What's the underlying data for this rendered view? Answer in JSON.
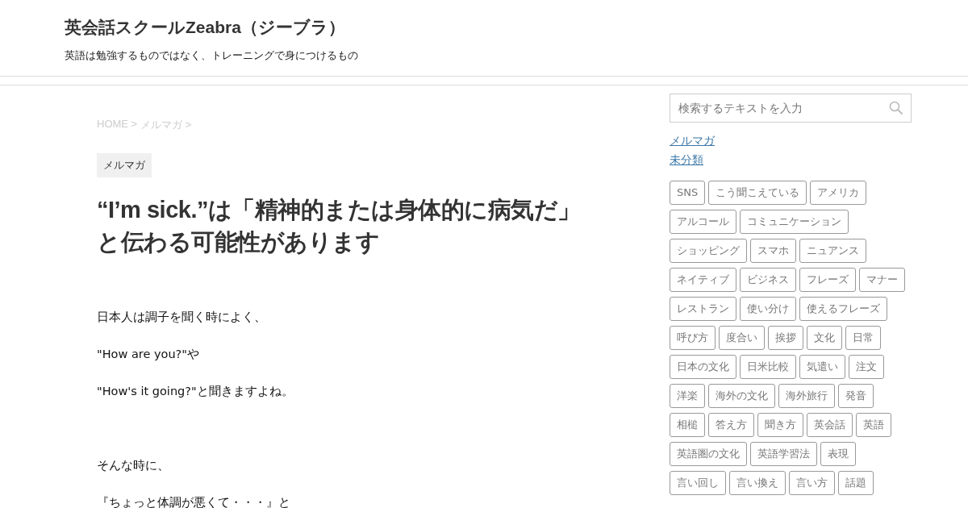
{
  "site": {
    "title": "英会話スクールZeabra（ジーブラ）",
    "tagline": "英語は勉強するものではなく、トレーニングで身につけるもの"
  },
  "breadcrumb": [
    "HOME >",
    "メルマガ >"
  ],
  "article": {
    "category": "メルマガ",
    "title": "“I’m sick.”は「精神的または身体的に病気だ」と伝わる可能性があります",
    "sections": [
      [
        "日本人は調子を聞く時によく、",
        "\"How are you?\"や",
        "\"How's it going?\"と聞きますよね。"
      ],
      [
        "そんな時に、",
        "『ちょっと体調が悪くて・・・』と"
      ]
    ]
  },
  "sidebar": {
    "search": {
      "placeholder": "検索するテキストを入力"
    },
    "categories": [
      "メルマガ",
      "未分類"
    ],
    "tags": [
      "SNS",
      "こう聞こえている",
      "アメリカ",
      "アルコール",
      "コミュニケーション",
      "ショッピング",
      "スマホ",
      "ニュアンス",
      "ネイティブ",
      "ビジネス",
      "フレーズ",
      "マナー",
      "レストラン",
      "使い分け",
      "使えるフレーズ",
      "呼び方",
      "度合い",
      "挨拶",
      "文化",
      "日常",
      "日本の文化",
      "日米比較",
      "気遣い",
      "注文",
      "洋楽",
      "海外の文化",
      "海外旅行",
      "発音",
      "相槌",
      "答え方",
      "聞き方",
      "英会話",
      "英語",
      "英語圏の文化",
      "英語学習法",
      "表現",
      "言い回し",
      "言い換え",
      "言い方",
      "話題"
    ]
  }
}
